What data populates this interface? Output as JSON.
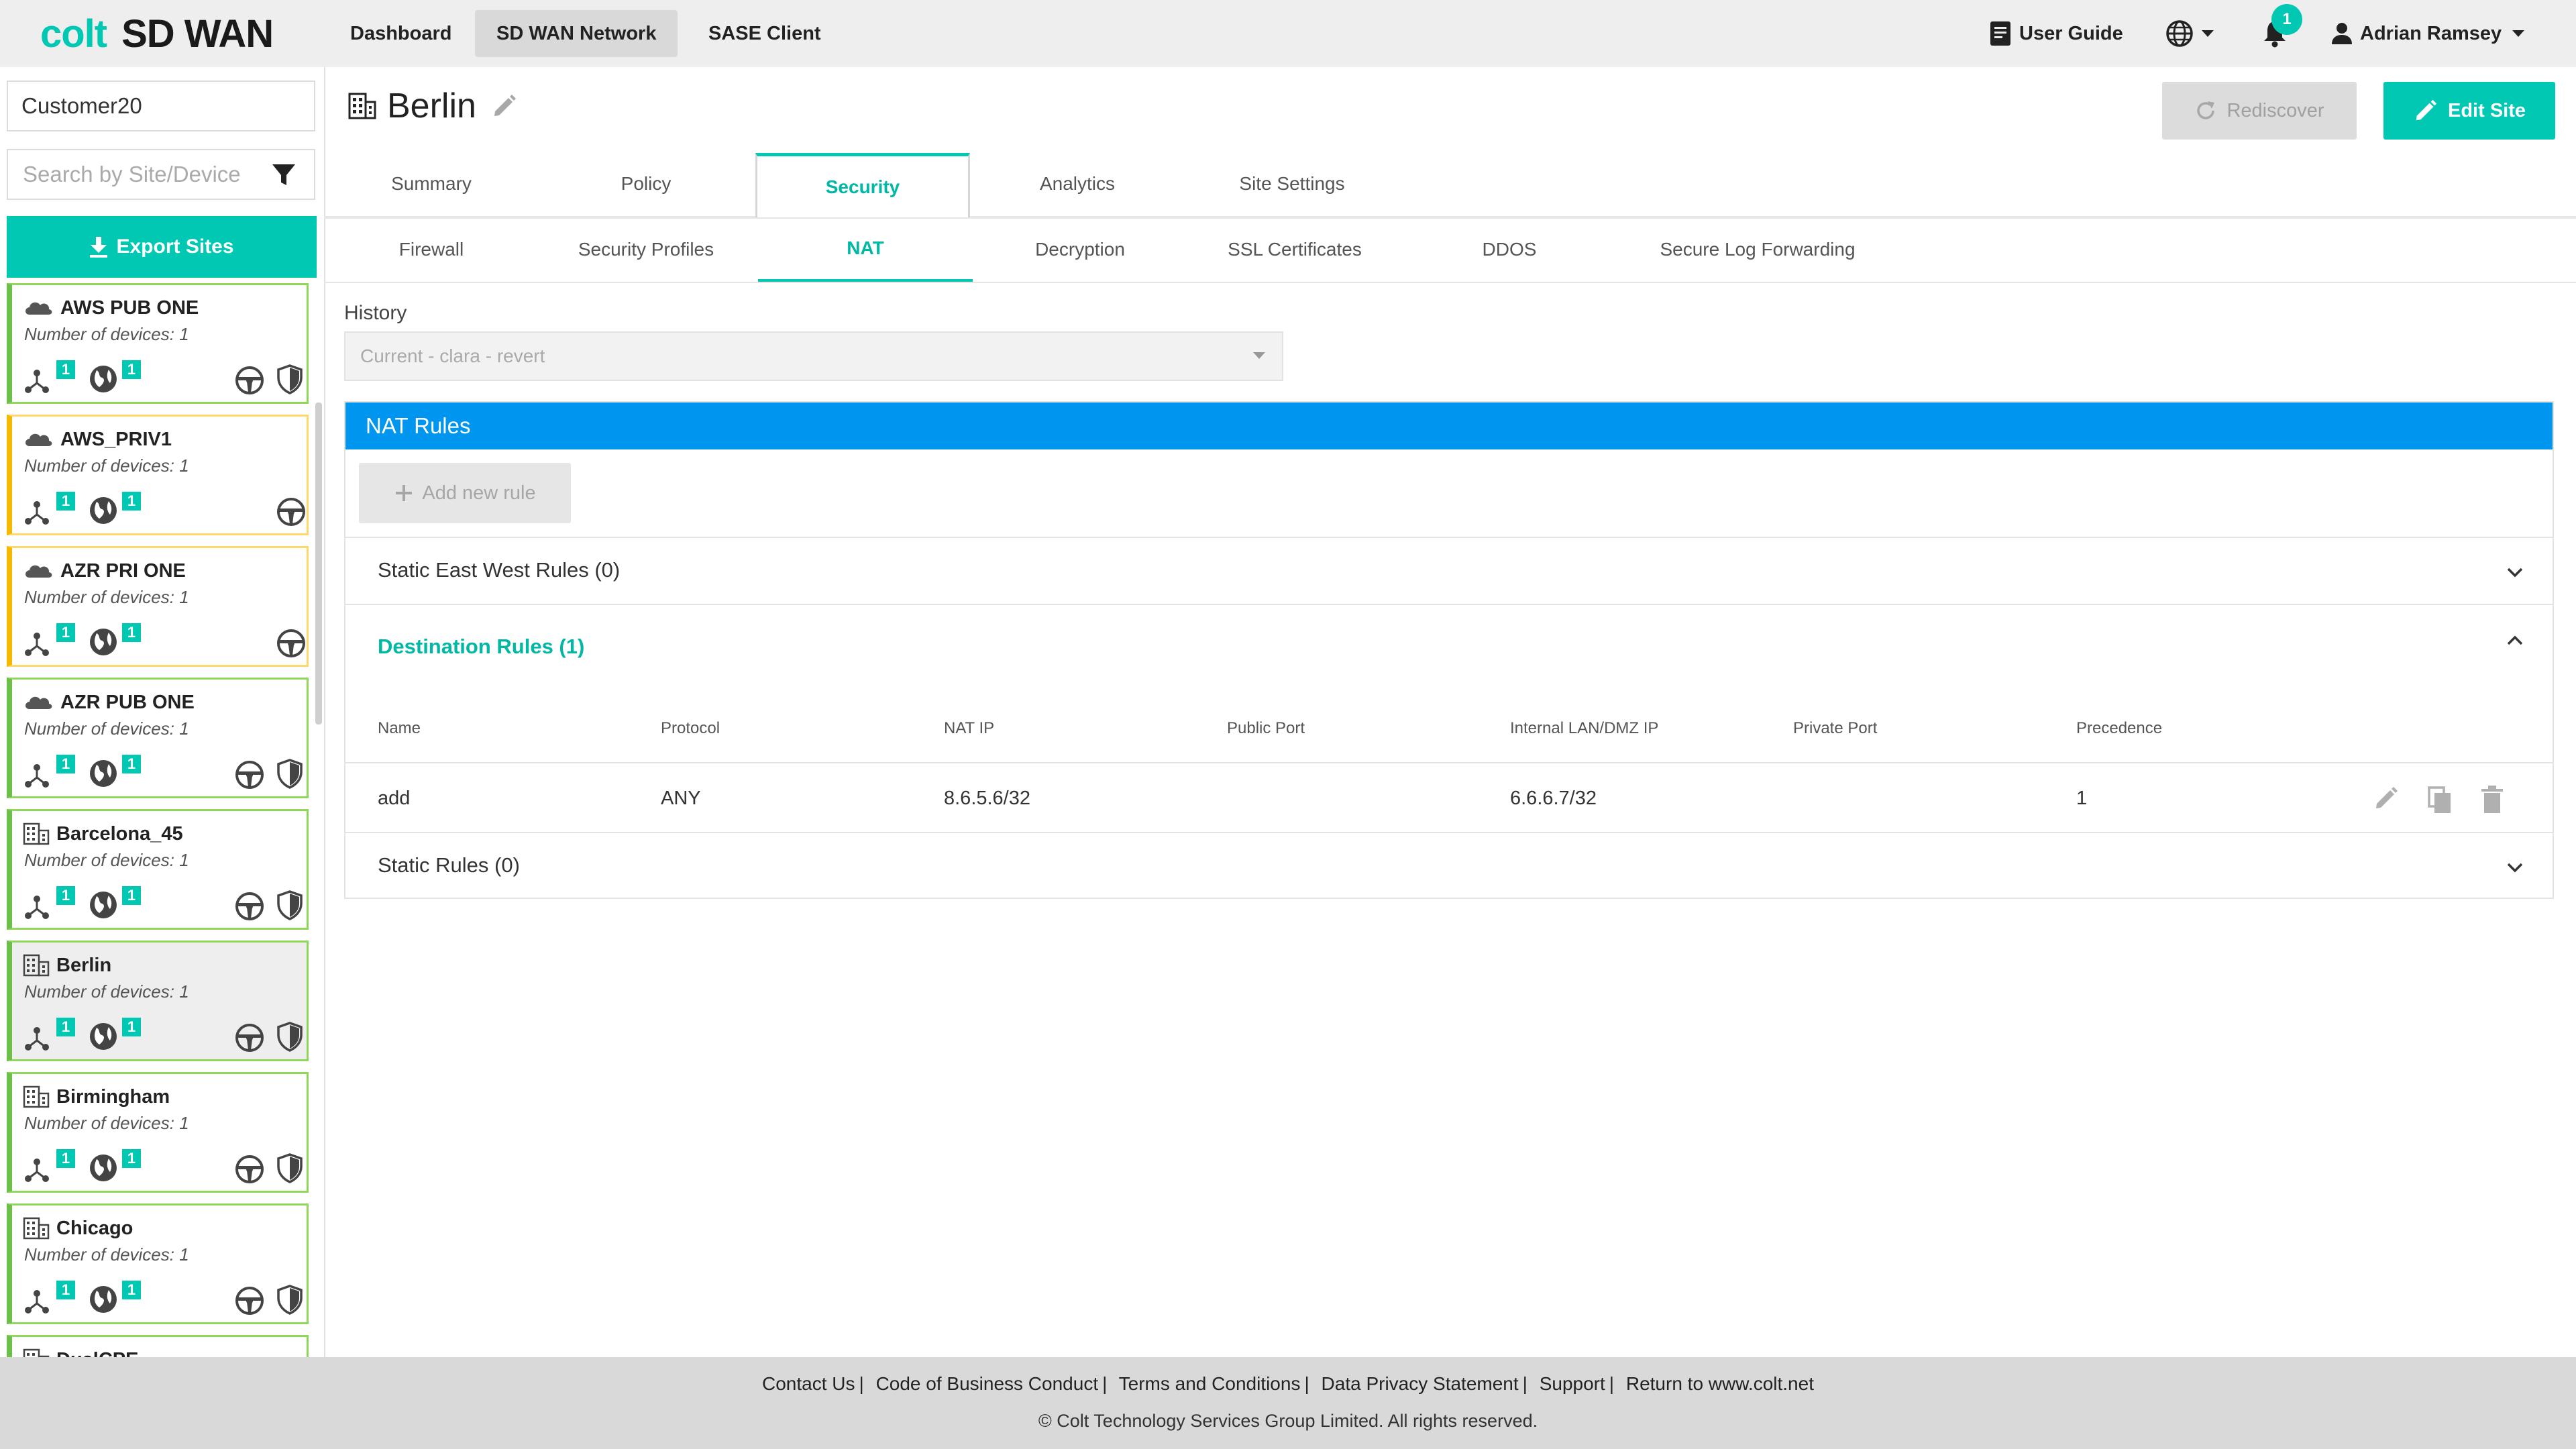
{
  "brand": {
    "colt": "colt",
    "product": "SD WAN"
  },
  "nav": {
    "dashboard": "Dashboard",
    "sdwan_network": "SD WAN Network",
    "sase_client": "SASE Client"
  },
  "header": {
    "user_guide": "User Guide",
    "notifications_count": "1",
    "user_name": "Adrian Ramsey"
  },
  "sidebar": {
    "customer": "Customer20",
    "search_placeholder": "Search by Site/Device",
    "export_label": "Export Sites",
    "sites": [
      {
        "name": "AWS PUB ONE",
        "devices": "Number of devices: 1",
        "type": "cloud",
        "status": "ok",
        "wan_count": "1",
        "internet_count": "1",
        "shield": true
      },
      {
        "name": "AWS_PRIV1",
        "devices": "Number of devices: 1",
        "type": "cloud",
        "status": "warning",
        "wan_count": "1",
        "internet_count": "1",
        "shield": false
      },
      {
        "name": "AZR PRI ONE",
        "devices": "Number of devices: 1",
        "type": "cloud",
        "status": "warning",
        "wan_count": "1",
        "internet_count": "1",
        "shield": false
      },
      {
        "name": "AZR PUB ONE",
        "devices": "Number of devices: 1",
        "type": "cloud",
        "status": "ok",
        "wan_count": "1",
        "internet_count": "1",
        "shield": true
      },
      {
        "name": "Barcelona_45",
        "devices": "Number of devices: 1",
        "type": "building",
        "status": "ok",
        "wan_count": "1",
        "internet_count": "1",
        "shield": true
      },
      {
        "name": "Berlin",
        "devices": "Number of devices: 1",
        "type": "building",
        "status": "ok",
        "selected": true,
        "wan_count": "1",
        "internet_count": "1",
        "shield": true
      },
      {
        "name": "Birmingham",
        "devices": "Number of devices: 1",
        "type": "building",
        "status": "ok",
        "wan_count": "1",
        "internet_count": "1",
        "shield": true
      },
      {
        "name": "Chicago",
        "devices": "Number of devices: 1",
        "type": "building",
        "status": "ok",
        "wan_count": "1",
        "internet_count": "1",
        "shield": true
      },
      {
        "name": "DualCPE",
        "type": "building",
        "status": "ok"
      }
    ]
  },
  "page": {
    "title": "Berlin",
    "rediscover_label": "Rediscover",
    "edit_site_label": "Edit Site",
    "tabs": [
      "Summary",
      "Policy",
      "Security",
      "Analytics",
      "Site Settings"
    ],
    "active_tab": "Security",
    "subtabs": [
      "Firewall",
      "Security Profiles",
      "NAT",
      "Decryption",
      "SSL Certificates",
      "DDOS",
      "Secure Log Forwarding"
    ],
    "active_subtab": "NAT",
    "history_label": "History",
    "history_value": "Current - clara - revert"
  },
  "nat": {
    "header": "NAT Rules",
    "add_rule_label": "Add new rule",
    "static_east_west": "Static East West Rules (0)",
    "destination": "Destination Rules (1)",
    "static": "Static Rules (0)",
    "columns": [
      "Name",
      "Protocol",
      "NAT IP",
      "Public Port",
      "Internal LAN/DMZ IP",
      "Private Port",
      "Precedence"
    ],
    "rows": [
      {
        "name": "add",
        "protocol": "ANY",
        "nat_ip": "8.6.5.6/32",
        "public_port": "",
        "internal_ip": "6.6.6.7/32",
        "private_port": "",
        "precedence": "1"
      }
    ]
  },
  "colors": {
    "accent": "#00c8b2",
    "nat_header": "#0096f0",
    "ok_border": "#6cc04a",
    "warn_border": "#f5b800"
  },
  "footer": {
    "links": [
      "Contact Us",
      "Code of Business Conduct",
      "Terms and Conditions",
      "Data Privacy Statement",
      "Support",
      "Return to www.colt.net"
    ],
    "copyright": "© Colt Technology Services Group Limited. All rights reserved."
  }
}
